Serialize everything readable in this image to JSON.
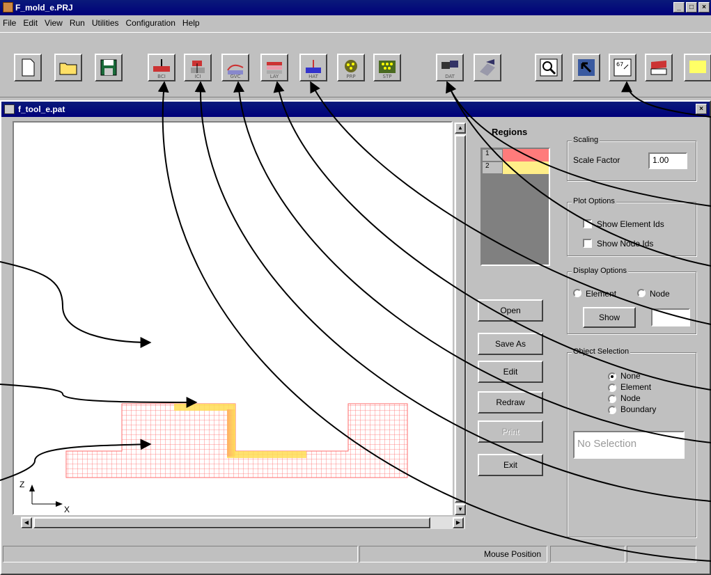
{
  "app": {
    "title": "F_mold_e.PRJ",
    "window_buttons": [
      "_",
      "□",
      "×"
    ]
  },
  "menu": [
    "File",
    "Edit",
    "View",
    "Run",
    "Utilities",
    "Configuration",
    "Help"
  ],
  "toolbar": {
    "buttons": [
      {
        "icon": "new-file-icon",
        "label": ""
      },
      {
        "icon": "open-folder-icon",
        "label": ""
      },
      {
        "icon": "save-disk-icon",
        "label": ""
      },
      {
        "icon": "bcd-icon",
        "label": "BCI"
      },
      {
        "icon": "bcn-icon",
        "label": "ICI"
      },
      {
        "icon": "gap-icon",
        "label": "GVC"
      },
      {
        "icon": "layer-icon",
        "label": "LAY"
      },
      {
        "icon": "heat-icon",
        "label": "HAT"
      },
      {
        "icon": "prp-icon",
        "label": "PRP"
      },
      {
        "icon": "stp-icon",
        "label": "STP"
      },
      {
        "icon": "dat-icon",
        "label": "DAT"
      },
      {
        "icon": "run-icon",
        "label": ""
      },
      {
        "icon": "zoom-icon",
        "label": ""
      },
      {
        "icon": "pointer-icon",
        "label": ""
      },
      {
        "icon": "calc-icon",
        "label": ""
      },
      {
        "icon": "book-icon",
        "label": ""
      },
      {
        "icon": "help-icon",
        "label": ""
      }
    ]
  },
  "child_window": {
    "title": "f_tool_e.pat",
    "close": "×"
  },
  "canvas": {
    "axis_z": "Z",
    "axis_x": "X"
  },
  "regions": {
    "header": "Regions",
    "items": [
      {
        "id": "1",
        "color": "#ff7b7b"
      },
      {
        "id": "2",
        "color": "#ffee88"
      }
    ]
  },
  "buttons": {
    "open": "Open",
    "save_as": "Save As",
    "edit": "Edit",
    "redraw": "Redraw",
    "print": "Print",
    "exit": "Exit"
  },
  "scaling": {
    "title": "Scaling",
    "label": "Scale Factor",
    "value": "1.00"
  },
  "plot_options": {
    "title": "Plot Options",
    "show_element_ids": "Show Element Ids",
    "show_node_ids": "Show Node Ids"
  },
  "display_options": {
    "title": "Display Options",
    "element": "Element",
    "node": "Node",
    "show": "Show",
    "value": ""
  },
  "object_selection": {
    "title": "Object Selection",
    "none": "None",
    "element": "Element",
    "node": "Node",
    "boundary": "Boundary",
    "status": "No Selection"
  },
  "statusbar": {
    "mouse_position": "Mouse Position"
  },
  "colors": {
    "title_bar": "#00007a",
    "chrome": "#c0c0c0",
    "mesh": "#ff6b6b",
    "mesh_highlight": "#ffdd55"
  }
}
